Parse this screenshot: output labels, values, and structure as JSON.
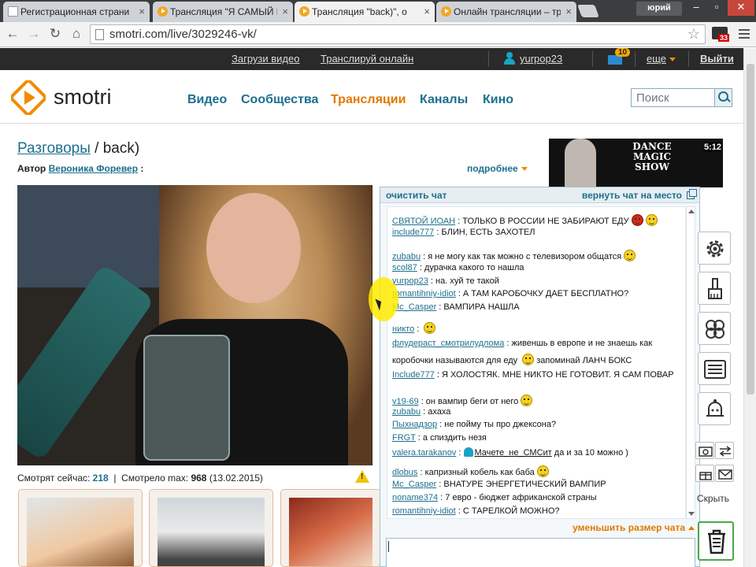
{
  "browser": {
    "tabs": [
      {
        "title": "Регистрационная страни",
        "icon": "document-icon"
      },
      {
        "title": "Трансляция \"Я САМЫЙ Г",
        "icon": "play-icon"
      },
      {
        "title": "Трансляция \"back)\", о",
        "icon": "play-icon"
      },
      {
        "title": "Онлайн трансляции – тр",
        "icon": "play-icon"
      }
    ],
    "active_tab": 2,
    "profile_name": "юрий",
    "url": "smotri.com/live/3029246-vk/",
    "extension_badge": "33"
  },
  "topbar": {
    "upload": "Загрузи видео",
    "broadcast": "Транслируй онлайн",
    "username": "yurpop23",
    "mail_count": "10",
    "more": "еще",
    "logout": "Выйти"
  },
  "header": {
    "logo_text": "smotri",
    "nav": [
      "Видео",
      "Сообщества",
      "Трансляции",
      "Каналы",
      "Кино"
    ],
    "active_nav": 2,
    "search_placeholder": "Поиск"
  },
  "stream": {
    "category": "Разговоры",
    "title_suffix": " / back)",
    "author_label": "Автор",
    "author_name": "Вероника Форевер",
    "author_colon": " :",
    "more_link": "подробнее",
    "viewers_now_label": "Смотрят сейчас:",
    "viewers_now": "218",
    "divider": "|",
    "viewers_max_label": "Смотрело max:",
    "viewers_max": "968",
    "viewers_max_date": "(13.02.2015)"
  },
  "ad": {
    "text": "DANCE MAGIC SHOW",
    "duration": "5:12"
  },
  "chat": {
    "clear": "очистить чат",
    "restore": "вернуть чат на место",
    "shrink": "уменьшить размер чата",
    "messages": [
      {
        "nick": "СВЯТОЙ ИОАН",
        "text": " : ТОЛЬКО В РОССИИ НЕ ЗАБИРАЮТ ЕДУ",
        "smile": "devil"
      },
      {
        "nick": "include777",
        "text": " : БЛИН, ЕСТЬ ЗАХОТЕЛ"
      },
      {
        "nick": "zubabu",
        "text": " : я не могу как так можно с телевизором общатся",
        "smile": "smile"
      },
      {
        "nick": "scol87",
        "text": " : дурачка какого то нашла"
      },
      {
        "nick": "yurpop23",
        "text": " : на. хуй те такой"
      },
      {
        "nick": "romantihniy-idiot",
        "text": " : А ТАМ КАРОБОЧКУ ДАЕТ БЕСПЛАТНО?"
      },
      {
        "nick": "Mc_Casper",
        "text": " : ВАМПИРА НАШЛА"
      },
      {
        "nick": "никто",
        "text": " : ",
        "smile": "smile"
      },
      {
        "nick": "флудераст_смотрилудлома",
        "text": " : живеншь в европе и не знаешь как"
      },
      {
        "nick": "",
        "text": "коробочки называются для еду ",
        "smile": "smile",
        "after": " запоминай ЛАНЧ БОКС"
      },
      {
        "nick": "Include777",
        "text": " : Я ХОЛОСТЯК. МНЕ НИКТО НЕ ГОТОВИТ. Я САМ ПОВАР"
      },
      {
        "nick": "v19-69",
        "text": " : он вампир беги от него",
        "smile": "smile"
      },
      {
        "nick": "zubabu",
        "text": " : ахаха"
      },
      {
        "nick": "Пыхнадзор",
        "text": " : не пойму ты про джексона?"
      },
      {
        "nick": "FRGT",
        "text": " : а спиздить незя"
      },
      {
        "nick": "valera.tarakanov",
        "text": " : ",
        "mention": "Мачете_не_СМСит",
        "after": " да и за 10 можно )"
      },
      {
        "nick": "dlobus",
        "text": " : капризный кобель как баба",
        "smile": "smile"
      },
      {
        "nick": "Mc_Casper",
        "text": " : ВНАТУРЕ ЭНЕРГЕТИЧЕСКИЙ ВАМПИР"
      },
      {
        "nick": "noname374",
        "text": " : 7 евро - бюджет африканской страны"
      },
      {
        "nick": "romantihniy-idiot",
        "text": " : С ТАРЕЛКОЙ МОЖНО?"
      }
    ]
  },
  "toolbar": {
    "hide_label": "Скрыть"
  },
  "colors": {
    "brand_orange": "#f08c00",
    "link_blue": "#1d6f8e",
    "topbar_bg": "#2a2a2a"
  }
}
